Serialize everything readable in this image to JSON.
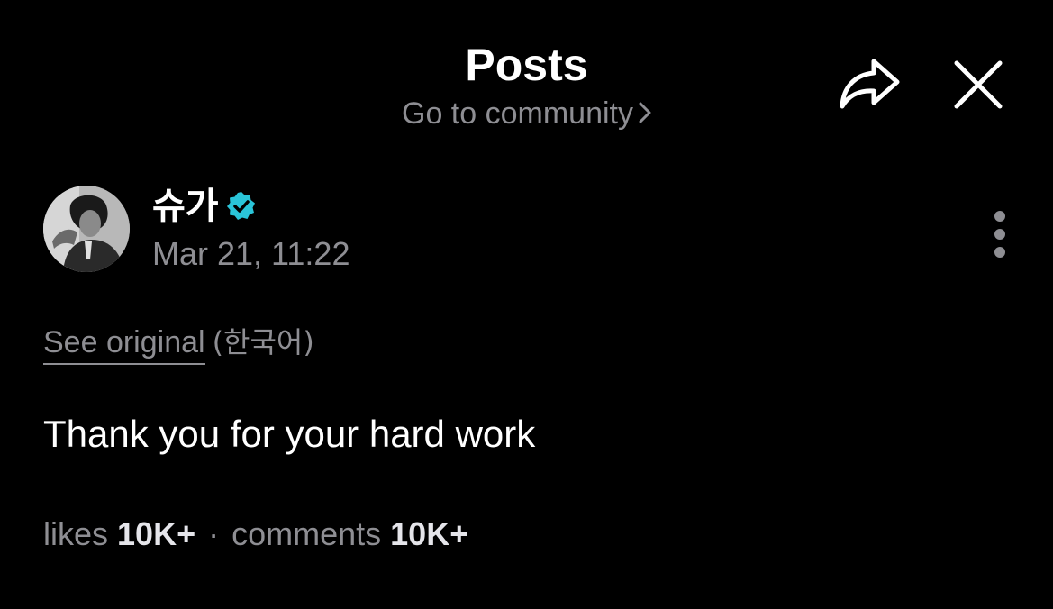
{
  "header": {
    "title": "Posts",
    "community_link": "Go to community"
  },
  "post": {
    "author_name": "슈가",
    "verified": true,
    "timestamp": "Mar 21, 11:22",
    "see_original": "See original",
    "original_language": "(한국어)",
    "text": "Thank you for your hard work"
  },
  "stats": {
    "likes_label": "likes",
    "likes_value": "10K+",
    "separator": "·",
    "comments_label": "comments",
    "comments_value": "10K+"
  },
  "icons": {
    "share": "share-icon",
    "close": "close-icon",
    "more": "more-vertical-icon",
    "verified": "verified-badge-icon"
  },
  "colors": {
    "background": "#000000",
    "primary_text": "#ffffff",
    "secondary_text": "#8e8e93",
    "verified_badge": "#2ac4d8"
  }
}
